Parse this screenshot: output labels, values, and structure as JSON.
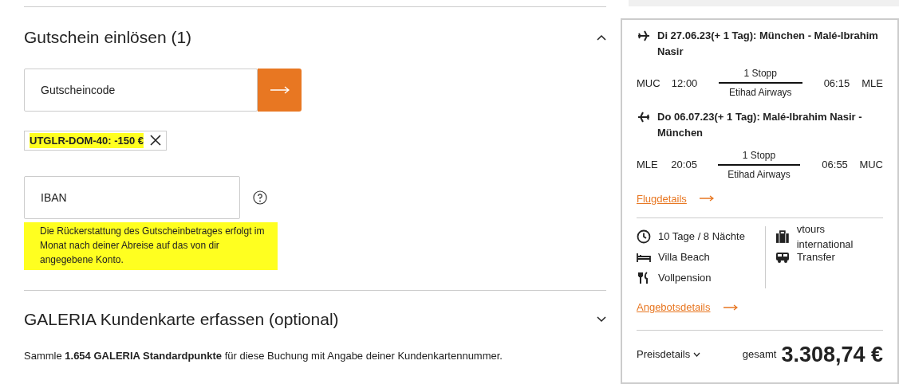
{
  "voucher_section": {
    "title": "Gutschein einlösen (1)",
    "expanded": true,
    "code_field": {
      "placeholder": "Gutscheincode"
    },
    "applied_voucher": {
      "text": "UTGLR-DOM-40: -150 €",
      "highlighted": true
    },
    "iban_field": {
      "placeholder": "IBAN"
    },
    "refund_note": {
      "text": "Die Rückerstattung des Gutscheinbetrages erfolgt im Monat nach deiner Abreise auf das von dir angegebene Konto.",
      "highlighted": true
    }
  },
  "loyalty_section": {
    "title": "GALERIA Kundenkarte erfassen (optional)",
    "expanded": false,
    "description": "Sammle **1.654 GALERIA Standardpunkte** für diese Buchung mit Angabe deiner Kundenkartennummer."
  },
  "summary": {
    "flights": [
      {
        "kind": "outbound",
        "title": "Di 27.06.23(+ 1 Tag): München - Malé-Ibrahim Nasir",
        "from": "MUC",
        "departure": "12:00",
        "stops": "1 Stopp",
        "airline": "Etihad Airways",
        "arrival": "06:15",
        "to": "MLE"
      },
      {
        "kind": "return",
        "title": "Do 06.07.23(+ 1 Tag): Malé-Ibrahim Nasir - München",
        "from": "MLE",
        "departure": "20:05",
        "stops": "1 Stopp",
        "airline": "Etihad Airways",
        "arrival": "06:55",
        "to": "MUC"
      }
    ],
    "flight_link": "Flugdetails",
    "facts_left": [
      {
        "kind": "duration",
        "text": "10 Tage / 8 Nächte"
      },
      {
        "kind": "hotel",
        "text": "Villa Beach"
      },
      {
        "kind": "board",
        "text": "Vollpension"
      }
    ],
    "facts_right": [
      {
        "kind": "operator",
        "text": "vtours international"
      },
      {
        "kind": "transfer",
        "text": "Transfer"
      }
    ],
    "offer_link": "Angebotsdetails",
    "price_details": "Preisdetails",
    "total_label": "gesamt",
    "total": "3.308,74 €"
  }
}
